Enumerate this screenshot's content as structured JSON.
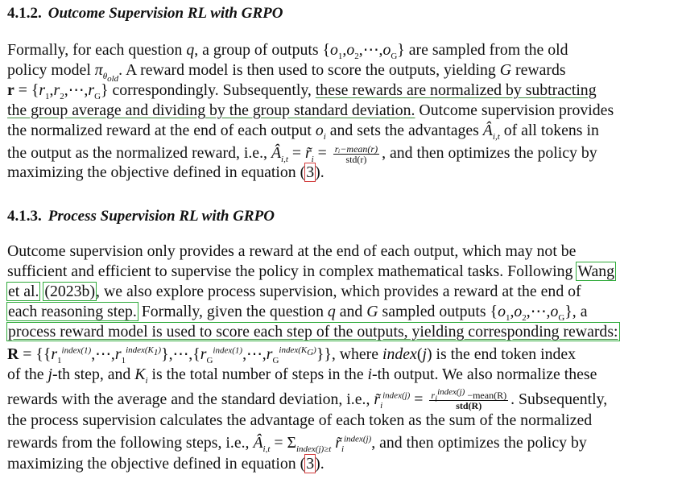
{
  "section1": {
    "number": "4.1.2.",
    "title": "Outcome Supervision RL with GRPO",
    "lines": [
      "Formally, for each question q, a group of outputs {o₁,o₂,⋯,o_G} are sampled from the old",
      "policy model π_θold. A reward model is then used to score the outputs, yielding G rewards",
      "r = {r₁,r₂,⋯,r_G} correspondingly. Subsequently, these rewards are normalized by subtracting",
      "the group average and dividing by the group standard deviation. Outcome supervision provides",
      "the normalized reward at the end of each output o_i and sets the advantages Â_i,t of all tokens in",
      "the output as the normalized reward, i.e., Â_i,t = r̃_i = (r_i − mean(r)) / std(r), and then optimizes the policy by",
      "maximizing the objective defined in equation (3)."
    ],
    "eq_ref": "3",
    "frac_num": "rᵢ−mean(r)",
    "frac_den": "std(r)"
  },
  "section2": {
    "number": "4.1.3.",
    "title": "Process Supervision RL with GRPO",
    "lines": [
      "Outcome supervision only provides a reward at the end of each output, which may not be",
      "sufficient and efficient to supervise the policy in complex mathematical tasks. Following Wang",
      "et al. (2023b), we also explore process supervision, which provides a reward at the end of",
      "each reasoning step. Formally, given the question q and G sampled outputs {o₁,o₂,⋯,o_G}, a",
      "process reward model is used to score each step of the outputs, yielding corresponding rewards:",
      "R = {{r₁^index(1),⋯,r₁^index(K₁)},⋯,{r_G^index(1),⋯,r_G^index(K_G)}}, where index(j) is the end token index",
      "of the j-th step, and K_i is the total number of steps in the i-th output. We also normalize these",
      "rewards with the average and the standard deviation, i.e., r̃_i^index(j) = (r_i^index(j) − mean(R)) / std(R). Subsequently,",
      "the process supervision calculates the advantage of each token as the sum of the normalized",
      "rewards from the following steps, i.e., Â_i,t = Σ_index(j)≥t r̃_i^index(j), and then optimizes the policy by",
      "maximizing the objective defined in equation (3)."
    ],
    "cite_author_1": "Wang",
    "cite_author_2": "et al.",
    "cite_year": "(2023b)",
    "eq_ref": "3",
    "frac_num": "mean(R)",
    "frac_den": "std(R)"
  },
  "colors": {
    "green_box": "#2faa3a",
    "red_box": "#d23a3a"
  }
}
